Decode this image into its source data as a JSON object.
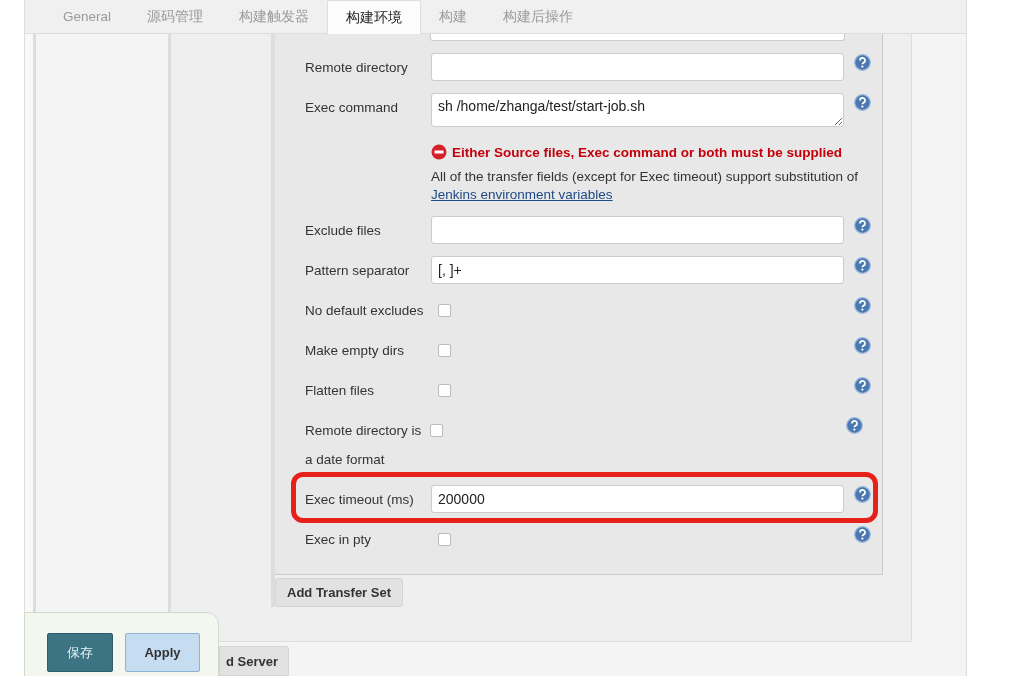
{
  "tabs": [
    {
      "label": "General",
      "selected": false
    },
    {
      "label": "源码管理",
      "selected": false
    },
    {
      "label": "构建触发器",
      "selected": false
    },
    {
      "label": "构建环境",
      "selected": true
    },
    {
      "label": "构建",
      "selected": false
    },
    {
      "label": "构建后操作",
      "selected": false
    }
  ],
  "rows": [
    {
      "kind": "text",
      "label": "Remote directory",
      "value": "",
      "highlighted": false
    },
    {
      "kind": "textarea",
      "label": "Exec command",
      "value": "sh /home/zhanga/test/start-job.sh",
      "highlighted": false
    },
    {
      "kind": "message",
      "error": "Either Source files, Exec command or both must be supplied",
      "note": "All of the transfer fields (except for Exec timeout) support substitution of",
      "link": "Jenkins environment variables"
    },
    {
      "kind": "text",
      "label": "Exclude files",
      "value": "",
      "highlighted": false
    },
    {
      "kind": "text",
      "label": "Pattern separator",
      "value": "[, ]+",
      "highlighted": false
    },
    {
      "kind": "checkbox",
      "label": "No default excludes",
      "checked": false,
      "highlighted": false
    },
    {
      "kind": "checkbox",
      "label": "Make empty dirs",
      "checked": false,
      "highlighted": false
    },
    {
      "kind": "checkbox",
      "label": "Flatten files",
      "checked": false,
      "highlighted": false
    },
    {
      "kind": "checkbox",
      "label": "Remote directory is a date format",
      "checked": false,
      "highlighted": false
    },
    {
      "kind": "text",
      "label": "Exec timeout (ms)",
      "value": "200000",
      "highlighted": true
    },
    {
      "kind": "checkbox",
      "label": "Exec in pty",
      "checked": false,
      "highlighted": false
    }
  ],
  "add_transfer_set": "Add Transfer Set",
  "add_server": "d Server",
  "save": "保存",
  "apply": "Apply"
}
